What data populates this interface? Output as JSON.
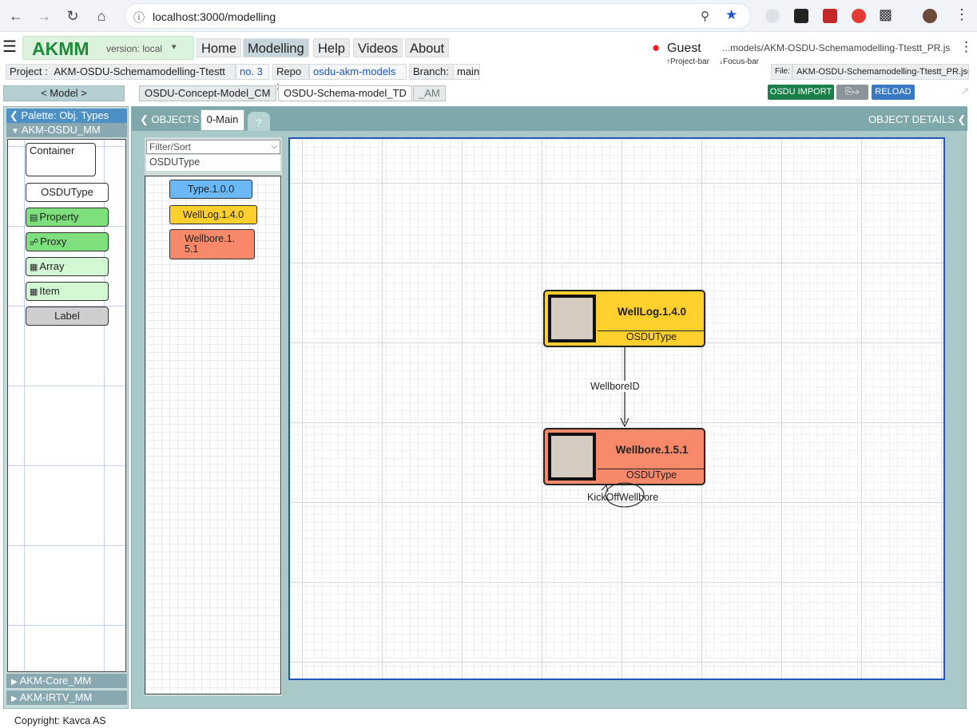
{
  "browser": {
    "url": "localhost:3000/modelling"
  },
  "app": {
    "logo": "AKMM",
    "version": "version: local",
    "menu": [
      "Home",
      "Modelling",
      "Help",
      "Videos",
      "About"
    ],
    "user": "Guest",
    "file_path": "...models/AKM-OSDU-Schemamodelling-Ttestt_PR.json",
    "project_bar_hint": "↑Project-bar",
    "focus_bar_hint": "↓Focus-bar"
  },
  "project_bar": {
    "project_label": "Project :",
    "project_name": "AKM-OSDU-Schemamodelling-Ttestt",
    "project_no": "no. 3",
    "repo_label": "Repo :",
    "repo_name": "osdu-akm-models",
    "branch_label": "Branch:",
    "branch_name": "main",
    "file_label": "File:",
    "file_name": "AKM-OSDU-Schemamodelling-Ttestt_PR.json"
  },
  "tabs_bar": {
    "model_button": "< Model >",
    "tabs": [
      "OSDU-Concept-Model_CM",
      "OSDU-Schema-model_TD",
      "_AM"
    ],
    "osdu_import": "OSDU IMPORT",
    "reload": "RELOAD"
  },
  "palette": {
    "title": "Palette: Obj. Types",
    "groups": [
      "AKM-OSDU_MM",
      "AKM-Core_MM",
      "AKM-IRTV_MM"
    ],
    "items": [
      "Container",
      "OSDUType",
      "Property",
      "Proxy",
      "Array",
      "Item",
      "Label"
    ]
  },
  "objects_panel": {
    "objects_label": "OBJECTS",
    "main_tab": "0-Main",
    "help_tab": "?",
    "details_label": "OBJECT DETAILS",
    "filter_placeholder": "Filter/Sort",
    "filter_type": "OSDUType",
    "items": [
      "Type.1.0.0",
      "WellLog.1.4.0",
      "Wellbore.1.5.1"
    ]
  },
  "diagram": {
    "nodes": [
      {
        "name": "WellLog.1.4.0",
        "type": "OSDUType",
        "color": "#ffd02b"
      },
      {
        "name": "Wellbore.1.5.1",
        "type": "OSDUType",
        "color": "#f7896a"
      }
    ],
    "links": [
      {
        "label": "WellboreID"
      },
      {
        "label": "KickOffWellbore"
      }
    ]
  },
  "footer": {
    "copyright": "Copyright: Kavca AS"
  }
}
